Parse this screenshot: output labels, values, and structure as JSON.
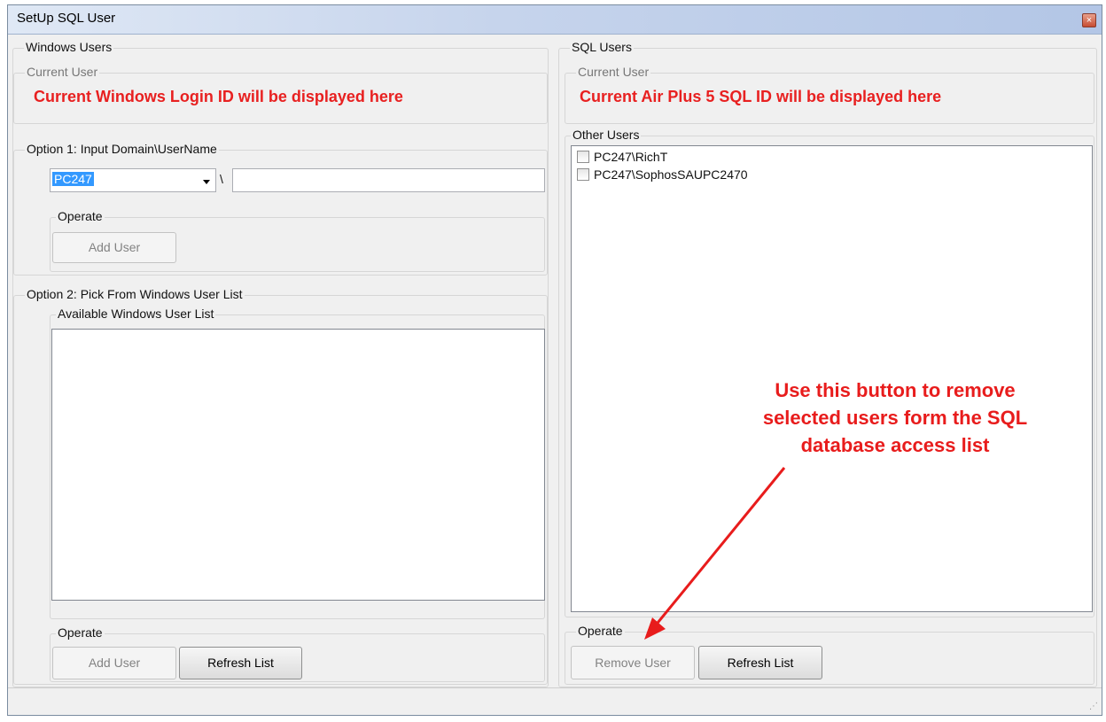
{
  "window": {
    "title": "SetUp SQL User",
    "close_glyph": "×"
  },
  "windows_users": {
    "label": "Windows Users",
    "current_user": {
      "label": "Current User",
      "message": "Current Windows Login ID will be displayed here"
    },
    "option1": {
      "label": "Option 1: Input Domain\\UserName",
      "domain_value": "PC247",
      "separator": "\\",
      "username_value": "",
      "operate_label": "Operate",
      "add_user_label": "Add User"
    },
    "option2": {
      "label": "Option 2: Pick From Windows User List",
      "available_label": "Available Windows User List",
      "items": [],
      "operate_label": "Operate",
      "add_user_label": "Add User",
      "refresh_label": "Refresh List"
    }
  },
  "sql_users": {
    "label": "SQL Users",
    "current_user": {
      "label": "Current User",
      "message": "Current Air Plus 5 SQL ID will be displayed here"
    },
    "other_users": {
      "label": "Other Users",
      "items": [
        {
          "label": "PC247\\RichT",
          "checked": false
        },
        {
          "label": "PC247\\SophosSAUPC2470",
          "checked": false
        }
      ]
    },
    "operate_label": "Operate",
    "remove_user_label": "Remove User",
    "refresh_label": "Refresh List"
  },
  "annotation": {
    "lines": [
      "Use this button to remove",
      "selected users form the SQL",
      "database access list"
    ]
  },
  "colors": {
    "annotation": "#e81c1c",
    "selection": "#3399ff"
  }
}
